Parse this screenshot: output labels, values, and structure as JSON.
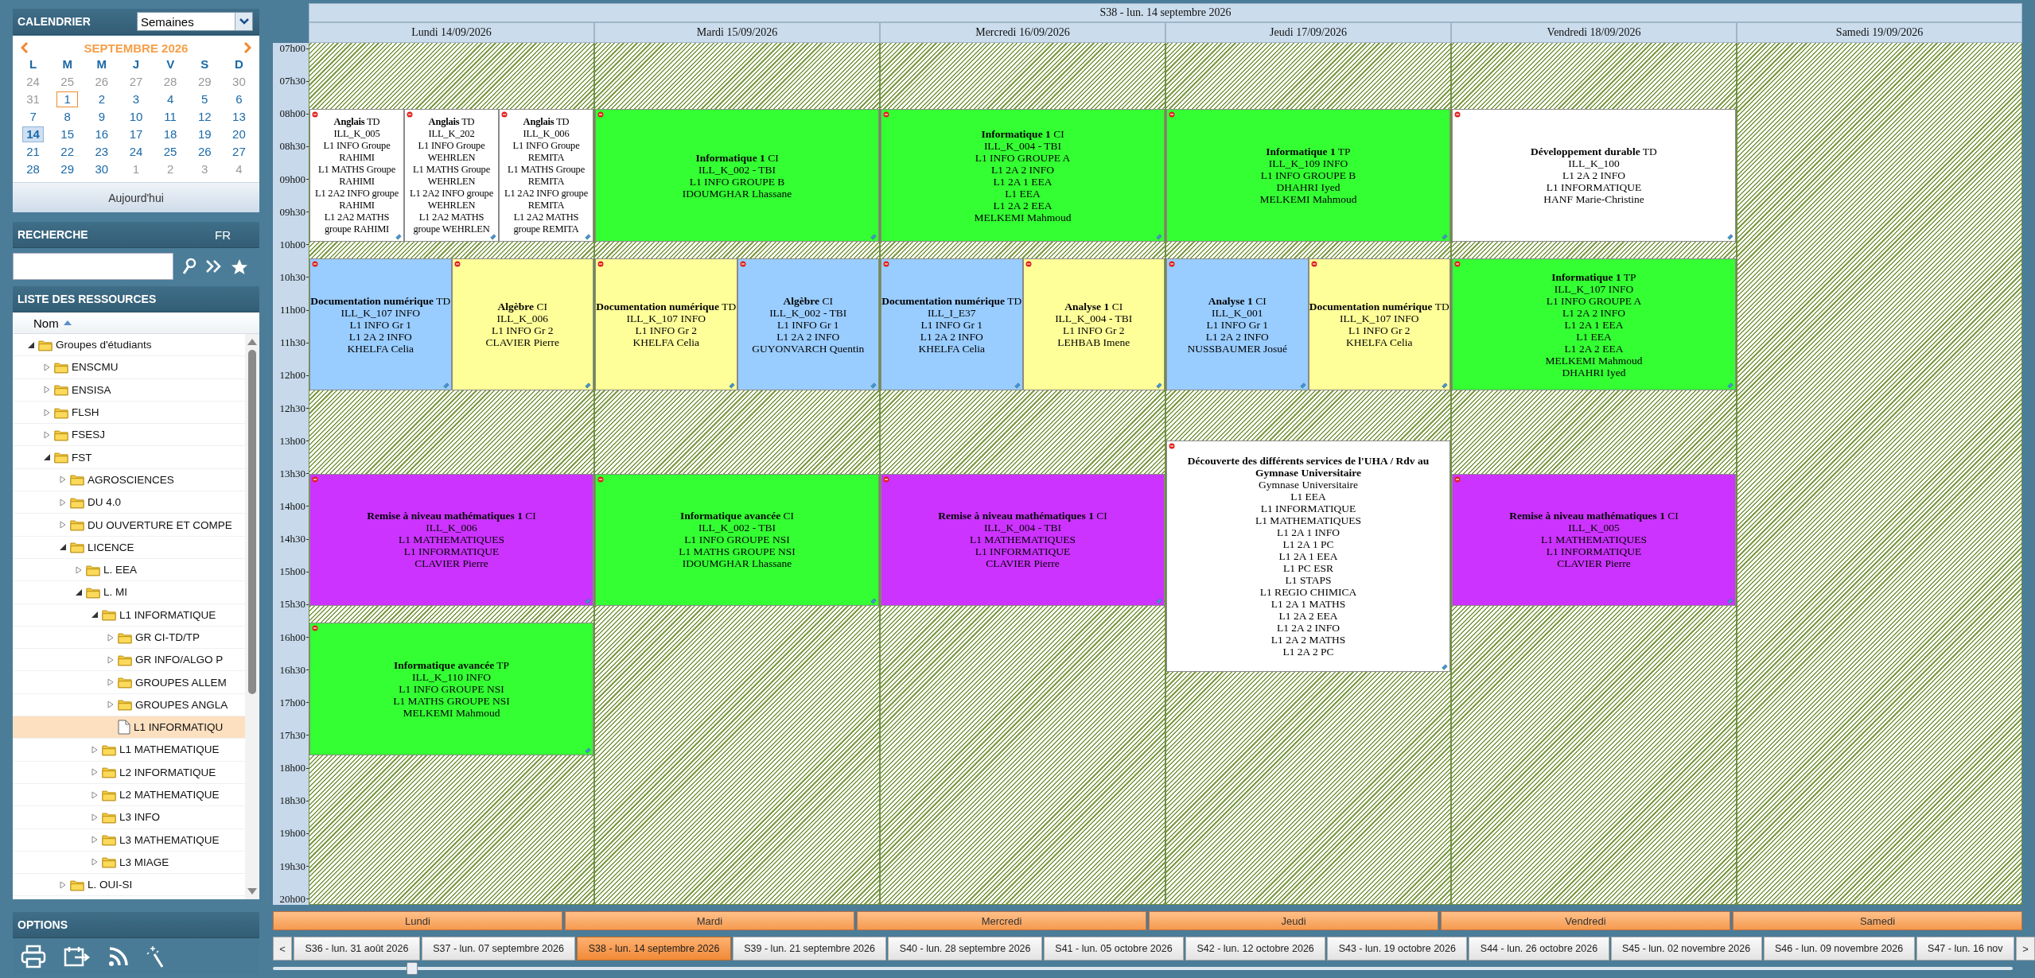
{
  "sidebar": {
    "calendar": {
      "title": "CALENDRIER",
      "view_select": "Semaines",
      "month": "SEPTEMBRE 2026",
      "weekdays": [
        "L",
        "M",
        "M",
        "J",
        "V",
        "S",
        "D"
      ],
      "days": [
        {
          "text": "24",
          "muted": true,
          "today": false,
          "selected": false
        },
        {
          "text": "25",
          "muted": true,
          "today": false,
          "selected": false
        },
        {
          "text": "26",
          "muted": true,
          "today": false,
          "selected": false
        },
        {
          "text": "27",
          "muted": true,
          "today": false,
          "selected": false
        },
        {
          "text": "28",
          "muted": true,
          "today": false,
          "selected": false
        },
        {
          "text": "29",
          "muted": true,
          "today": false,
          "selected": false
        },
        {
          "text": "30",
          "muted": true,
          "today": false,
          "selected": false
        },
        {
          "text": "31",
          "muted": true,
          "today": false,
          "selected": false
        },
        {
          "text": "1",
          "muted": false,
          "today": true,
          "selected": false
        },
        {
          "text": "2",
          "muted": false,
          "today": false,
          "selected": false
        },
        {
          "text": "3",
          "muted": false,
          "today": false,
          "selected": false
        },
        {
          "text": "4",
          "muted": false,
          "today": false,
          "selected": false
        },
        {
          "text": "5",
          "muted": false,
          "today": false,
          "selected": false
        },
        {
          "text": "6",
          "muted": false,
          "today": false,
          "selected": false
        },
        {
          "text": "7",
          "muted": false,
          "today": false,
          "selected": false
        },
        {
          "text": "8",
          "muted": false,
          "today": false,
          "selected": false
        },
        {
          "text": "9",
          "muted": false,
          "today": false,
          "selected": false
        },
        {
          "text": "10",
          "muted": false,
          "today": false,
          "selected": false
        },
        {
          "text": "11",
          "muted": false,
          "today": false,
          "selected": false
        },
        {
          "text": "12",
          "muted": false,
          "today": false,
          "selected": false
        },
        {
          "text": "13",
          "muted": false,
          "today": false,
          "selected": false
        },
        {
          "text": "14",
          "muted": false,
          "today": false,
          "selected": true
        },
        {
          "text": "15",
          "muted": false,
          "today": false,
          "selected": false
        },
        {
          "text": "16",
          "muted": false,
          "today": false,
          "selected": false
        },
        {
          "text": "17",
          "muted": false,
          "today": false,
          "selected": false
        },
        {
          "text": "18",
          "muted": false,
          "today": false,
          "selected": false
        },
        {
          "text": "19",
          "muted": false,
          "today": false,
          "selected": false
        },
        {
          "text": "20",
          "muted": false,
          "today": false,
          "selected": false
        },
        {
          "text": "21",
          "muted": false,
          "today": false,
          "selected": false
        },
        {
          "text": "22",
          "muted": false,
          "today": false,
          "selected": false
        },
        {
          "text": "23",
          "muted": false,
          "today": false,
          "selected": false
        },
        {
          "text": "24",
          "muted": false,
          "today": false,
          "selected": false
        },
        {
          "text": "25",
          "muted": false,
          "today": false,
          "selected": false
        },
        {
          "text": "26",
          "muted": false,
          "today": false,
          "selected": false
        },
        {
          "text": "27",
          "muted": false,
          "today": false,
          "selected": false
        },
        {
          "text": "28",
          "muted": false,
          "today": false,
          "selected": false
        },
        {
          "text": "29",
          "muted": false,
          "today": false,
          "selected": false
        },
        {
          "text": "30",
          "muted": false,
          "today": false,
          "selected": false
        },
        {
          "text": "1",
          "muted": true,
          "today": false,
          "selected": false
        },
        {
          "text": "2",
          "muted": true,
          "today": false,
          "selected": false
        },
        {
          "text": "3",
          "muted": true,
          "today": false,
          "selected": false
        },
        {
          "text": "4",
          "muted": true,
          "today": false,
          "selected": false
        }
      ],
      "today_button": "Aujourd'hui"
    },
    "search": {
      "title": "RECHERCHE",
      "language": "FR"
    },
    "resources": {
      "title": "LISTE DES RESSOURCES",
      "column": "Nom",
      "tree": [
        {
          "label": "Groupes d'étudiants",
          "kind": "folder",
          "expanded": true,
          "selected": false,
          "children": [
            {
              "label": "ENSCMU",
              "kind": "folder",
              "expanded": false,
              "selected": false
            },
            {
              "label": "ENSISA",
              "kind": "folder",
              "expanded": false,
              "selected": false
            },
            {
              "label": "FLSH",
              "kind": "folder",
              "expanded": false,
              "selected": false
            },
            {
              "label": "FSESJ",
              "kind": "folder",
              "expanded": false,
              "selected": false
            },
            {
              "label": "FST",
              "kind": "folder",
              "expanded": true,
              "selected": false,
              "children": [
                {
                  "label": "AGROSCIENCES",
                  "kind": "folder",
                  "expanded": false,
                  "selected": false
                },
                {
                  "label": "DU 4.0",
                  "kind": "folder",
                  "expanded": false,
                  "selected": false
                },
                {
                  "label": "DU OUVERTURE ET COMPE",
                  "kind": "folder",
                  "expanded": false,
                  "selected": false
                },
                {
                  "label": "LICENCE",
                  "kind": "folder",
                  "expanded": true,
                  "selected": false,
                  "children": [
                    {
                      "label": "L. EEA",
                      "kind": "folder",
                      "expanded": false,
                      "selected": false
                    },
                    {
                      "label": "L. MI",
                      "kind": "folder",
                      "expanded": true,
                      "selected": false,
                      "children": [
                        {
                          "label": "L1 INFORMATIQUE",
                          "kind": "folder",
                          "expanded": true,
                          "selected": false,
                          "children": [
                            {
                              "label": "GR CI-TD/TP",
                              "kind": "folder",
                              "expanded": false,
                              "selected": false
                            },
                            {
                              "label": "GR INFO/ALGO P",
                              "kind": "folder",
                              "expanded": false,
                              "selected": false
                            },
                            {
                              "label": "GROUPES ALLEM",
                              "kind": "folder",
                              "expanded": false,
                              "selected": false
                            },
                            {
                              "label": "GROUPES ANGLA",
                              "kind": "folder",
                              "expanded": false,
                              "selected": false
                            },
                            {
                              "label": "L1 INFORMATIQU",
                              "kind": "file",
                              "selected": true
                            }
                          ]
                        },
                        {
                          "label": "L1 MATHEMATIQUE",
                          "kind": "folder",
                          "expanded": false,
                          "selected": false
                        },
                        {
                          "label": "L2 INFORMATIQUE",
                          "kind": "folder",
                          "expanded": false,
                          "selected": false
                        },
                        {
                          "label": "L2 MATHEMATIQUE",
                          "kind": "folder",
                          "expanded": false,
                          "selected": false
                        },
                        {
                          "label": "L3 INFO",
                          "kind": "folder",
                          "expanded": false,
                          "selected": false
                        },
                        {
                          "label": "L3 MATHEMATIQUE",
                          "kind": "folder",
                          "expanded": false,
                          "selected": false
                        },
                        {
                          "label": "L3 MIAGE",
                          "kind": "folder",
                          "expanded": false,
                          "selected": false
                        }
                      ]
                    }
                  ]
                },
                {
                  "label": "L. OUI-SI",
                  "kind": "folder",
                  "expanded": false,
                  "selected": false
                }
              ]
            }
          ]
        }
      ]
    },
    "options": {
      "title": "OPTIONS"
    }
  },
  "schedule": {
    "week_title": "S38 - lun. 14 septembre 2026",
    "times": [
      "07h00",
      "07h30",
      "08h00",
      "08h30",
      "09h00",
      "09h30",
      "10h00",
      "10h30",
      "11h00",
      "11h30",
      "12h00",
      "12h30",
      "13h00",
      "13h30",
      "14h00",
      "14h30",
      "15h00",
      "15h30",
      "16h00",
      "16h30",
      "17h00",
      "17h30",
      "18h00",
      "18h30",
      "19h00",
      "19h30",
      "20h00"
    ],
    "days": [
      {
        "label": "Lundi 14/09/2026",
        "groups": [
          {
            "events": [
              {
                "title": "**Anglais** TD",
                "color": "#ffffff",
                "lines": [
                  "ILL_K_005",
                  "L1 INFO Groupe RAHIMI",
                  "L1 MATHS Groupe RAHIMI",
                  "L1 2A2 INFO groupe RAHIMI",
                  "L1 2A2 MATHS groupe RAHIMI"
                ]
              },
              {
                "title": "**Anglais** TD",
                "color": "#ffffff",
                "lines": [
                  "ILL_K_202",
                  "L1 INFO Groupe WEHRLEN",
                  "L1 MATHS Groupe WEHRLEN",
                  "L1 2A2 INFO groupe WEHRLEN",
                  "L1 2A2 MATHS groupe WEHRLEN"
                ]
              },
              {
                "title": "**Anglais** TD",
                "color": "#ffffff",
                "lines": [
                  "ILL_K_006",
                  "L1 INFO Groupe REMITA",
                  "L1 MATHS Groupe REMITA",
                  "L1 2A2 INFO groupe REMITA",
                  "L1 2A2 MATHS groupe REMITA"
                ]
              }
            ]
          },
          {
            "events": [
              {
                "title": "**Documentation numérique** TD",
                "color": "#99ccff",
                "lines": [
                  "ILL_K_107 INFO",
                  "L1 INFO Gr 1",
                  "L1 2A 2 INFO",
                  "KHELFA Celia"
                ]
              },
              {
                "title": "**Algèbre** CI",
                "color": "#ffff99",
                "lines": [
                  "ILL_K_006",
                  "L1 INFO Gr 2",
                  "CLAVIER Pierre"
                ]
              }
            ]
          },
          {
            "events": [
              {
                "title": "**Remise à niveau mathématiques 1** CI",
                "color": "#cc33ff",
                "lines": [
                  "ILL_K_006",
                  "L1 MATHEMATIQUES",
                  "L1 INFORMATIQUE",
                  "CLAVIER Pierre"
                ]
              }
            ]
          },
          {
            "events": [
              {
                "title": "**Informatique avancée** TP",
                "color": "#33ff33",
                "lines": [
                  "ILL_K_110 INFO",
                  "L1 INFO GROUPE NSI",
                  "L1 MATHS GROUPE NSI",
                  "MELKEMI Mahmoud"
                ]
              }
            ]
          }
        ]
      },
      {
        "label": "Mardi 15/09/2026",
        "groups": [
          {
            "events": [
              {
                "title": "**Informatique 1** CI",
                "color": "#33ff33",
                "lines": [
                  "ILL_K_002 - TBI",
                  "L1 INFO GROUPE B",
                  "IDOUMGHAR Lhassane"
                ]
              }
            ]
          },
          {
            "events": [
              {
                "title": "**Documentation numérique** TD",
                "color": "#ffff99",
                "lines": [
                  "ILL_K_107 INFO",
                  "L1 INFO Gr 2",
                  "KHELFA Celia"
                ]
              },
              {
                "title": "**Algèbre** CI",
                "color": "#99ccff",
                "lines": [
                  "ILL_K_002 - TBI",
                  "L1 INFO Gr 1",
                  "L1 2A 2 INFO",
                  "GUYONVARCH Quentin"
                ]
              }
            ]
          },
          {
            "events": [
              {
                "title": "**Informatique avancée** CI",
                "color": "#33ff33",
                "lines": [
                  "ILL_K_002 - TBI",
                  "L1 INFO GROUPE NSI",
                  "L1 MATHS GROUPE NSI",
                  "IDOUMGHAR Lhassane"
                ]
              }
            ]
          }
        ]
      },
      {
        "label": "Mercredi 16/09/2026",
        "groups": [
          {
            "events": [
              {
                "title": "**Informatique 1** CI",
                "color": "#33ff33",
                "lines": [
                  "ILL_K_004 - TBI",
                  "L1 INFO GROUPE A",
                  "L1 2A 2 INFO",
                  "L1 2A 1 EEA",
                  "L1 EEA",
                  "L1 2A 2 EEA",
                  "MELKEMI Mahmoud"
                ]
              }
            ]
          },
          {
            "events": [
              {
                "title": "**Documentation numérique** TD",
                "color": "#99ccff",
                "lines": [
                  "ILL_I_E37",
                  "L1 INFO Gr 1",
                  "L1 2A 2 INFO",
                  "KHELFA Celia"
                ]
              },
              {
                "title": "**Analyse 1** CI",
                "color": "#ffff99",
                "lines": [
                  "ILL_K_004 - TBI",
                  "L1 INFO Gr 2",
                  "LEHBAB Imene"
                ]
              }
            ]
          },
          {
            "events": [
              {
                "title": "**Remise à niveau mathématiques 1** CI",
                "color": "#cc33ff",
                "lines": [
                  "ILL_K_004 - TBI",
                  "L1 MATHEMATIQUES",
                  "L1 INFORMATIQUE",
                  "CLAVIER Pierre"
                ]
              }
            ]
          }
        ]
      },
      {
        "label": "Jeudi 17/09/2026",
        "groups": [
          {
            "events": [
              {
                "title": "**Informatique 1** TP",
                "color": "#33ff33",
                "lines": [
                  "ILL_K_109 INFO",
                  "L1 INFO GROUPE B",
                  "DHAHRI Iyed",
                  "MELKEMI Mahmoud"
                ]
              }
            ]
          },
          {
            "events": [
              {
                "title": "**Analyse 1** CI",
                "color": "#99ccff",
                "lines": [
                  "ILL_K_001",
                  "L1 INFO Gr 1",
                  "L1 2A 2 INFO",
                  "NUSSBAUMER Josué"
                ]
              },
              {
                "title": "**Documentation numérique** TD",
                "color": "#ffff99",
                "lines": [
                  "ILL_K_107 INFO",
                  "L1 INFO Gr 2",
                  "KHELFA Celia"
                ]
              }
            ]
          },
          {
            "events": [
              {
                "title": "**Découverte des différents services de l'UHA / Rdv au Gymnase Universitaire**",
                "color": "#ffffff",
                "lines": [
                  "Gymnase Universitaire",
                  "L1 EEA",
                  "L1 INFORMATIQUE",
                  "L1 MATHEMATIQUES",
                  "L1 2A 1 INFO",
                  "L1 2A 1 PC",
                  "L1 2A 1 EEA",
                  "L1 PC ESR",
                  "L1 STAPS",
                  "L1 REGIO CHIMICA",
                  "L1 2A 1 MATHS",
                  "L1 2A 2 EEA",
                  "L1 2A 2 INFO",
                  "L1 2A 2 MATHS",
                  "L1 2A 2 PC"
                ]
              }
            ]
          }
        ]
      },
      {
        "label": "Vendredi 18/09/2026",
        "groups": [
          {
            "events": [
              {
                "title": "**Développement durable** TD",
                "color": "#ffffff",
                "lines": [
                  "ILL_K_100",
                  "L1 2A 2 INFO",
                  "L1 INFORMATIQUE",
                  "HANF Marie-Christine"
                ]
              }
            ]
          },
          {
            "events": [
              {
                "title": "**Informatique 1** TP",
                "color": "#33ff33",
                "lines": [
                  "ILL_K_107 INFO",
                  "L1 INFO GROUPE A",
                  "L1 2A 2 INFO",
                  "L1 2A 1 EEA",
                  "L1 EEA",
                  "L1 2A 2 EEA",
                  "MELKEMI Mahmoud",
                  "DHAHRI Iyed"
                ]
              }
            ]
          },
          {
            "events": [
              {
                "title": "**Remise à niveau mathématiques 1** CI",
                "color": "#cc33ff",
                "lines": [
                  "ILL_K_005",
                  "L1 MATHEMATIQUES",
                  "L1 INFORMATIQUE",
                  "CLAVIER Pierre"
                ]
              }
            ]
          }
        ]
      },
      {
        "label": "Samedi 19/09/2026"
      }
    ],
    "day_buttons": [
      "Lundi",
      "Mardi",
      "Mercredi",
      "Jeudi",
      "Vendredi",
      "Samedi"
    ],
    "week_nav": {
      "prev": "<",
      "next": ">",
      "weeks": [
        {
          "label": "S36 - lun. 31 août 2026",
          "selected": false
        },
        {
          "label": "S37 - lun. 07 septembre 2026",
          "selected": false
        },
        {
          "label": "S38 - lun. 14 septembre 2026",
          "selected": true
        },
        {
          "label": "S39 - lun. 21 septembre 2026",
          "selected": false
        },
        {
          "label": "S40 - lun. 28 septembre 2026",
          "selected": false
        },
        {
          "label": "S41 - lun. 05 octobre 2026",
          "selected": false
        },
        {
          "label": "S42 - lun. 12 octobre 2026",
          "selected": false
        },
        {
          "label": "S43 - lun. 19 octobre 2026",
          "selected": false
        },
        {
          "label": "S44 - lun. 26 octobre 2026",
          "selected": false
        },
        {
          "label": "S45 - lun. 02 novembre 2026",
          "selected": false
        },
        {
          "label": "S46 - lun. 09 novembre 2026",
          "selected": false
        },
        {
          "label": "S47 - lun. 16 nov",
          "selected": false
        }
      ]
    },
    "timeline": {
      "level": 0.08
    }
  }
}
